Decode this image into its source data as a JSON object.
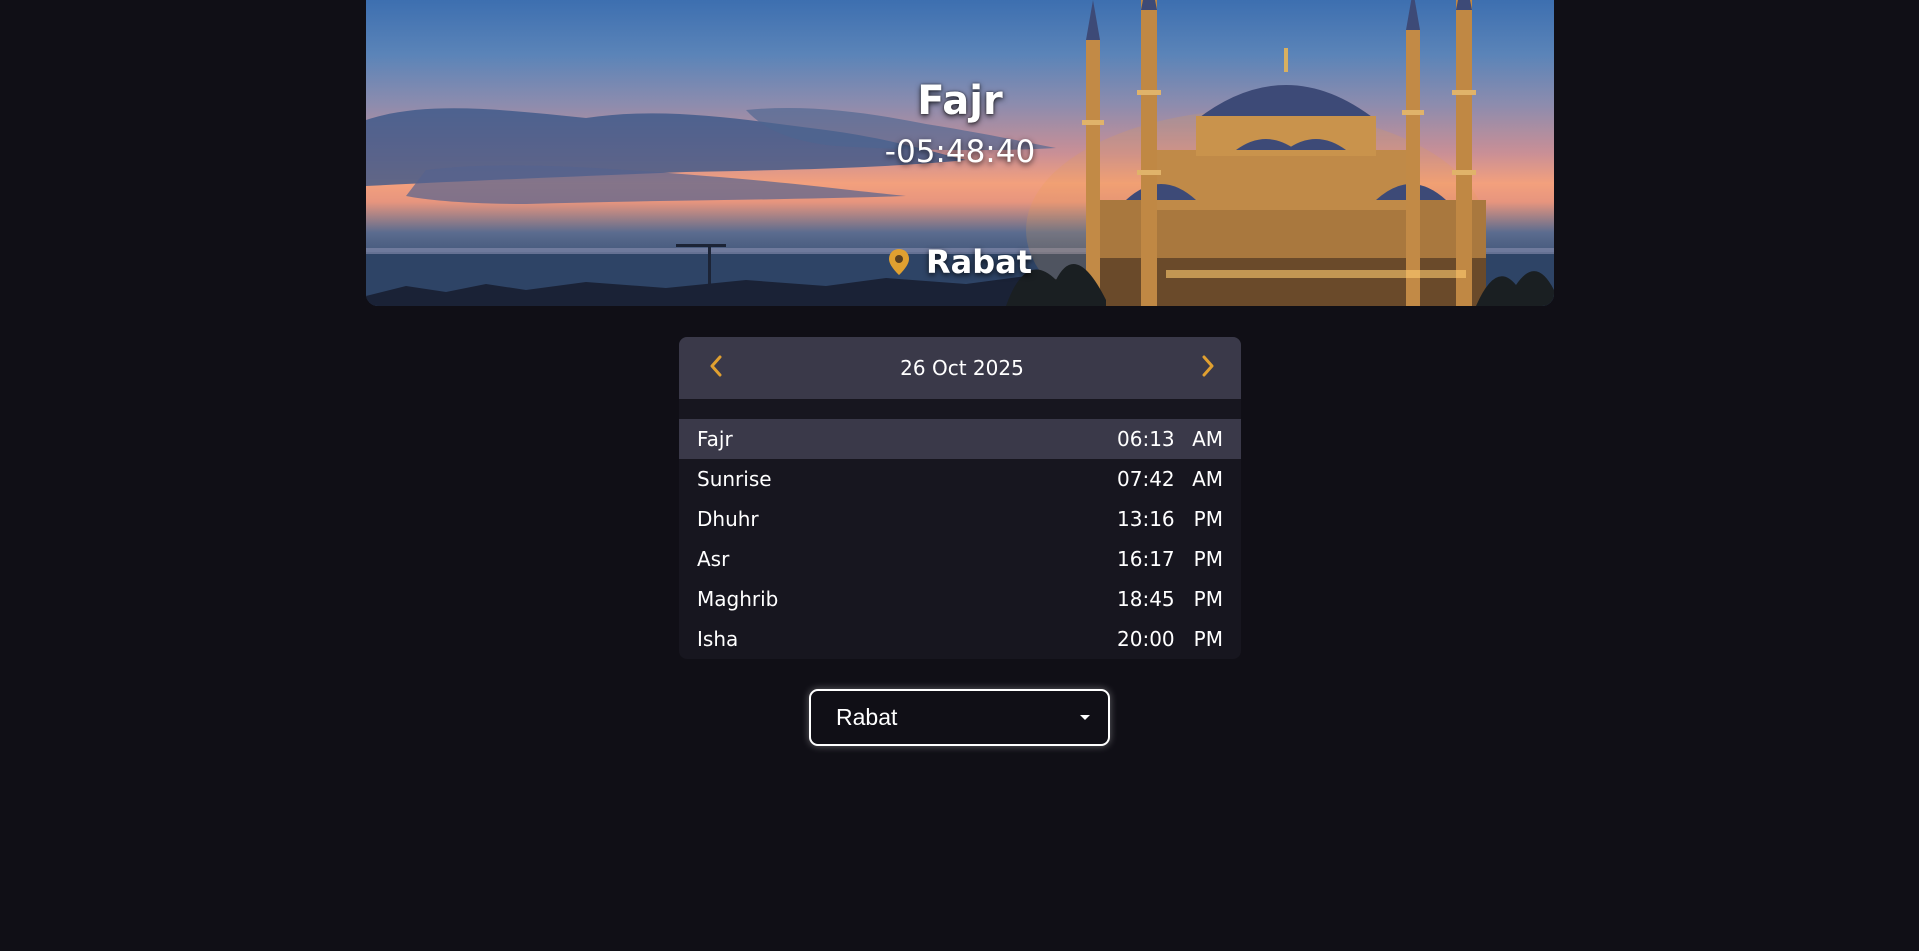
{
  "hero": {
    "prayer_name": "Fajr",
    "countdown": "-05:48:40",
    "location": "Rabat"
  },
  "card": {
    "date": "26 Oct 2025",
    "prayers": [
      {
        "name": "Fajr",
        "time": "06:13",
        "period": "AM",
        "active": true
      },
      {
        "name": "Sunrise",
        "time": "07:42",
        "period": "AM",
        "active": false
      },
      {
        "name": "Dhuhr",
        "time": "13:16",
        "period": "PM",
        "active": false
      },
      {
        "name": "Asr",
        "time": "16:17",
        "period": "PM",
        "active": false
      },
      {
        "name": "Maghrib",
        "time": "18:45",
        "period": "PM",
        "active": false
      },
      {
        "name": "Isha",
        "time": "20:00",
        "period": "PM",
        "active": false
      }
    ]
  },
  "city_select": {
    "selected": "Rabat"
  },
  "icons": {
    "prev": "chevron-left-icon",
    "next": "chevron-right-icon",
    "location": "map-pin-icon",
    "dropdown": "caret-down-icon"
  },
  "colors": {
    "background": "#100f16",
    "card": "#17161f",
    "card_header": "#3a3949",
    "accent": "#e0a030",
    "text": "#ffffff"
  }
}
